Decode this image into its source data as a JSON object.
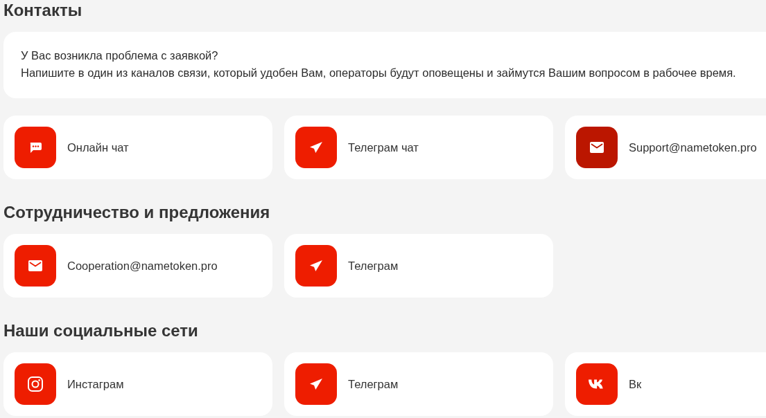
{
  "sections": [
    {
      "title": "Контакты",
      "notice": [
        "У Вас возникла проблема с заявкой?",
        "Напишите в один из каналов связи, который удобен Вам, операторы будут оповещены и займутся Вашим вопросом в рабочее время."
      ],
      "channels": [
        {
          "kind": "chat",
          "label": "Онлайн чат",
          "color": "#ee1d00"
        },
        {
          "kind": "telegram",
          "label": "Телеграм чат",
          "color": "#ee1d00"
        },
        {
          "kind": "email",
          "label": "Support@nametoken.pro",
          "color": "#bb1600"
        }
      ]
    },
    {
      "title": "Сотрудничество и предложения",
      "channels": [
        {
          "kind": "email",
          "label": "Cooperation@nametoken.pro",
          "color": "#ee1d00"
        },
        {
          "kind": "telegram",
          "label": "Телеграм",
          "color": "#ee1d00"
        }
      ]
    },
    {
      "title": "Наши социальные сети",
      "channels": [
        {
          "kind": "instagram",
          "label": "Инстаграм",
          "color": "#ee1d00"
        },
        {
          "kind": "telegram",
          "label": "Телеграм",
          "color": "#ee1d00"
        },
        {
          "kind": "vk",
          "label": "Вк",
          "color": "#ee1d00"
        }
      ]
    }
  ]
}
